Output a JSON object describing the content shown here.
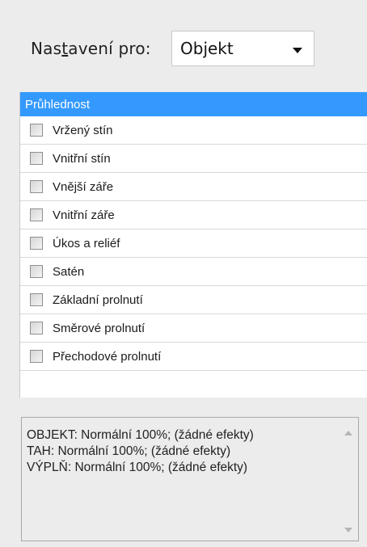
{
  "settings": {
    "label_pre": "Nas",
    "label_accel": "t",
    "label_post": "avení pro:",
    "selected": "Objekt"
  },
  "transparency": {
    "header": "Průhlednost",
    "effects": [
      {
        "label": "Vržený stín",
        "checked": false
      },
      {
        "label": "Vnitřní stín",
        "checked": false
      },
      {
        "label": "Vnější záře",
        "checked": false
      },
      {
        "label": "Vnitřní záře",
        "checked": false
      },
      {
        "label": "Úkos a reliéf",
        "checked": false
      },
      {
        "label": "Satén",
        "checked": false
      },
      {
        "label": "Základní prolnutí",
        "checked": false
      },
      {
        "label": "Směrové prolnutí",
        "checked": false
      },
      {
        "label": "Přechodové prolnutí",
        "checked": false
      }
    ]
  },
  "summary": {
    "lines": [
      "OBJEKT: Normální 100%; (žádné efekty)",
      "TAH: Normální 100%; (žádné efekty)",
      "VÝPLŇ: Normální 100%; (žádné efekty)"
    ]
  },
  "colors": {
    "header_bg": "#3399ff",
    "panel_bg": "#ffffff",
    "window_bg": "#ececec"
  }
}
